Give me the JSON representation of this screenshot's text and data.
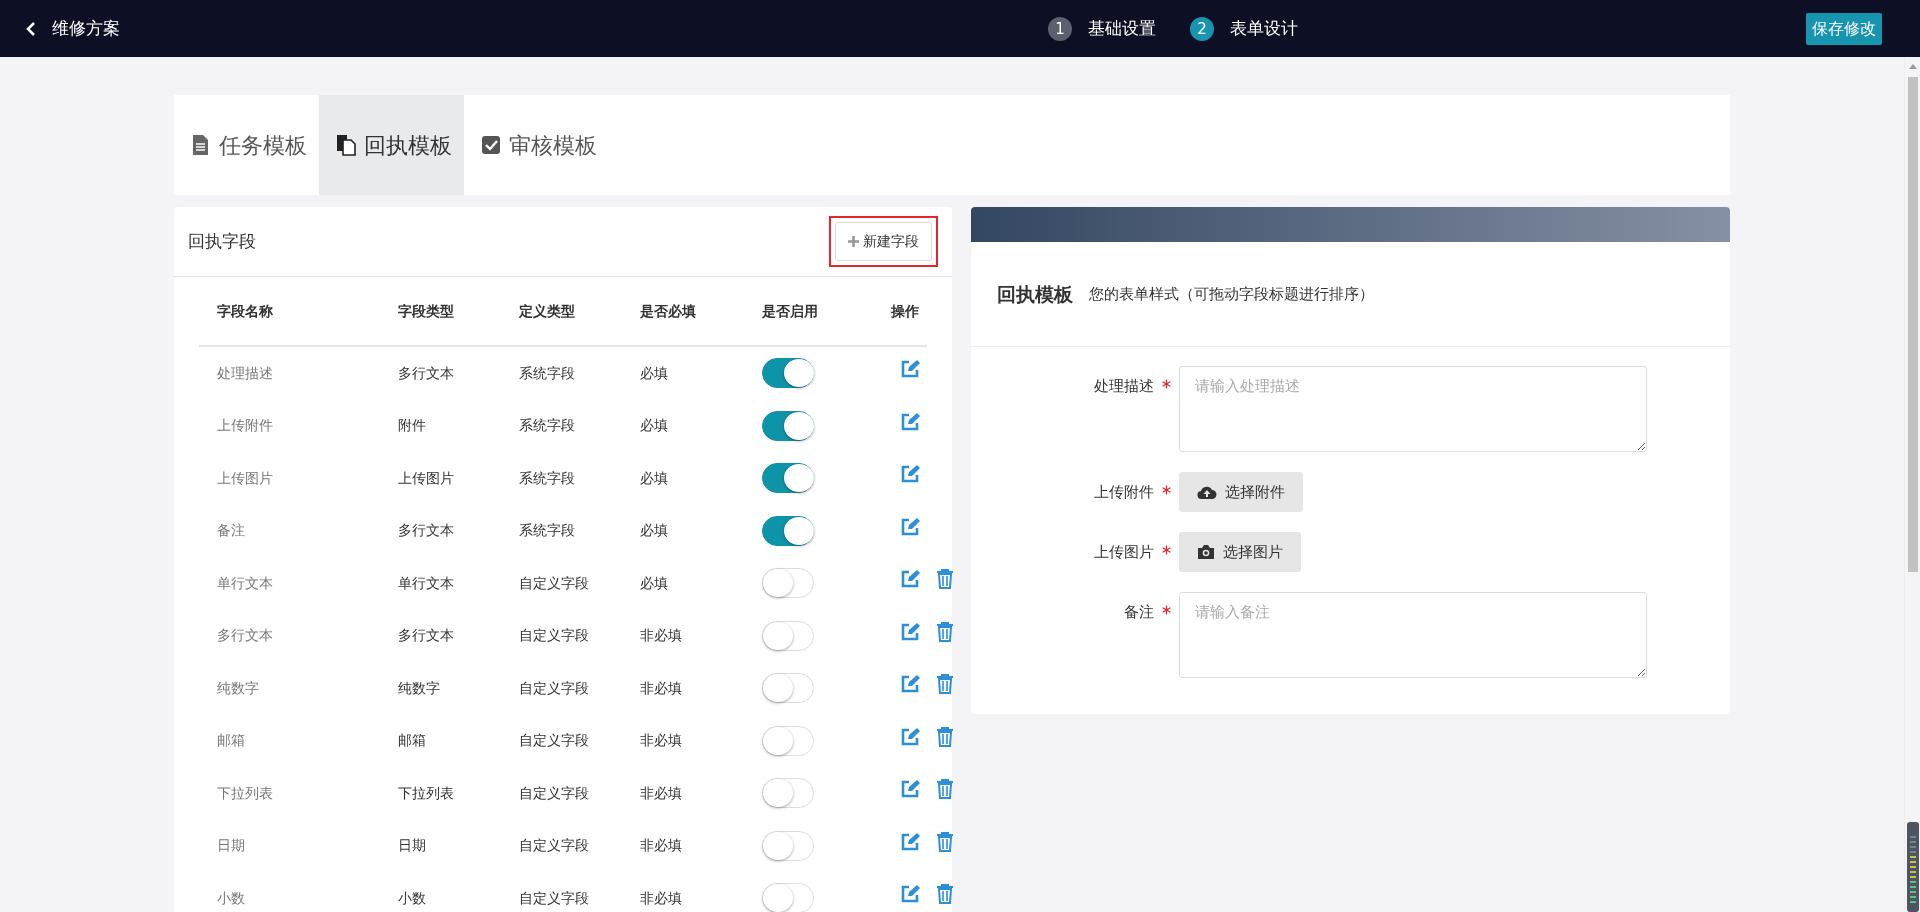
{
  "header": {
    "back_label": "维修方案",
    "steps": [
      {
        "number": "1",
        "label": "基础设置",
        "selected": false
      },
      {
        "number": "2",
        "label": "表单设计",
        "selected": true
      }
    ],
    "save_button": "保存修改"
  },
  "tabs": [
    {
      "label": "任务模板",
      "selected": false
    },
    {
      "label": "回执模板",
      "selected": true
    },
    {
      "label": "审核模板",
      "selected": false
    }
  ],
  "fields_panel": {
    "title": "回执字段",
    "new_button": "新建字段",
    "columns": [
      "字段名称",
      "字段类型",
      "定义类型",
      "是否必填",
      "是否启用",
      "操作"
    ],
    "rows": [
      {
        "name": "处理描述",
        "field_type": "多行文本",
        "definition": "系统字段",
        "required": "必填",
        "enabled": true,
        "deletable": false
      },
      {
        "name": "上传附件",
        "field_type": "附件",
        "definition": "系统字段",
        "required": "必填",
        "enabled": true,
        "deletable": false
      },
      {
        "name": "上传图片",
        "field_type": "上传图片",
        "definition": "系统字段",
        "required": "必填",
        "enabled": true,
        "deletable": false
      },
      {
        "name": "备注",
        "field_type": "多行文本",
        "definition": "系统字段",
        "required": "必填",
        "enabled": true,
        "deletable": false
      },
      {
        "name": "单行文本",
        "field_type": "单行文本",
        "definition": "自定义字段",
        "required": "必填",
        "enabled": false,
        "deletable": true
      },
      {
        "name": "多行文本",
        "field_type": "多行文本",
        "definition": "自定义字段",
        "required": "非必填",
        "enabled": false,
        "deletable": true
      },
      {
        "name": "纯数字",
        "field_type": "纯数字",
        "definition": "自定义字段",
        "required": "非必填",
        "enabled": false,
        "deletable": true
      },
      {
        "name": "邮箱",
        "field_type": "邮箱",
        "definition": "自定义字段",
        "required": "非必填",
        "enabled": false,
        "deletable": true
      },
      {
        "name": "下拉列表",
        "field_type": "下拉列表",
        "definition": "自定义字段",
        "required": "非必填",
        "enabled": false,
        "deletable": true
      },
      {
        "name": "日期",
        "field_type": "日期",
        "definition": "自定义字段",
        "required": "非必填",
        "enabled": false,
        "deletable": true
      },
      {
        "name": "小数",
        "field_type": "小数",
        "definition": "自定义字段",
        "required": "非必填",
        "enabled": false,
        "deletable": true
      }
    ]
  },
  "preview": {
    "title": "回执模板",
    "subtitle": "您的表单样式（可拖动字段标题进行排序）",
    "fields": [
      {
        "kind": "textarea",
        "label": "处理描述",
        "required": true,
        "placeholder": "请输入处理描述"
      },
      {
        "kind": "file",
        "label": "上传附件",
        "required": true,
        "button": "选择附件"
      },
      {
        "kind": "image",
        "label": "上传图片",
        "required": true,
        "button": "选择图片"
      },
      {
        "kind": "textarea",
        "label": "备注",
        "required": true,
        "placeholder": "请输入备注"
      }
    ]
  }
}
